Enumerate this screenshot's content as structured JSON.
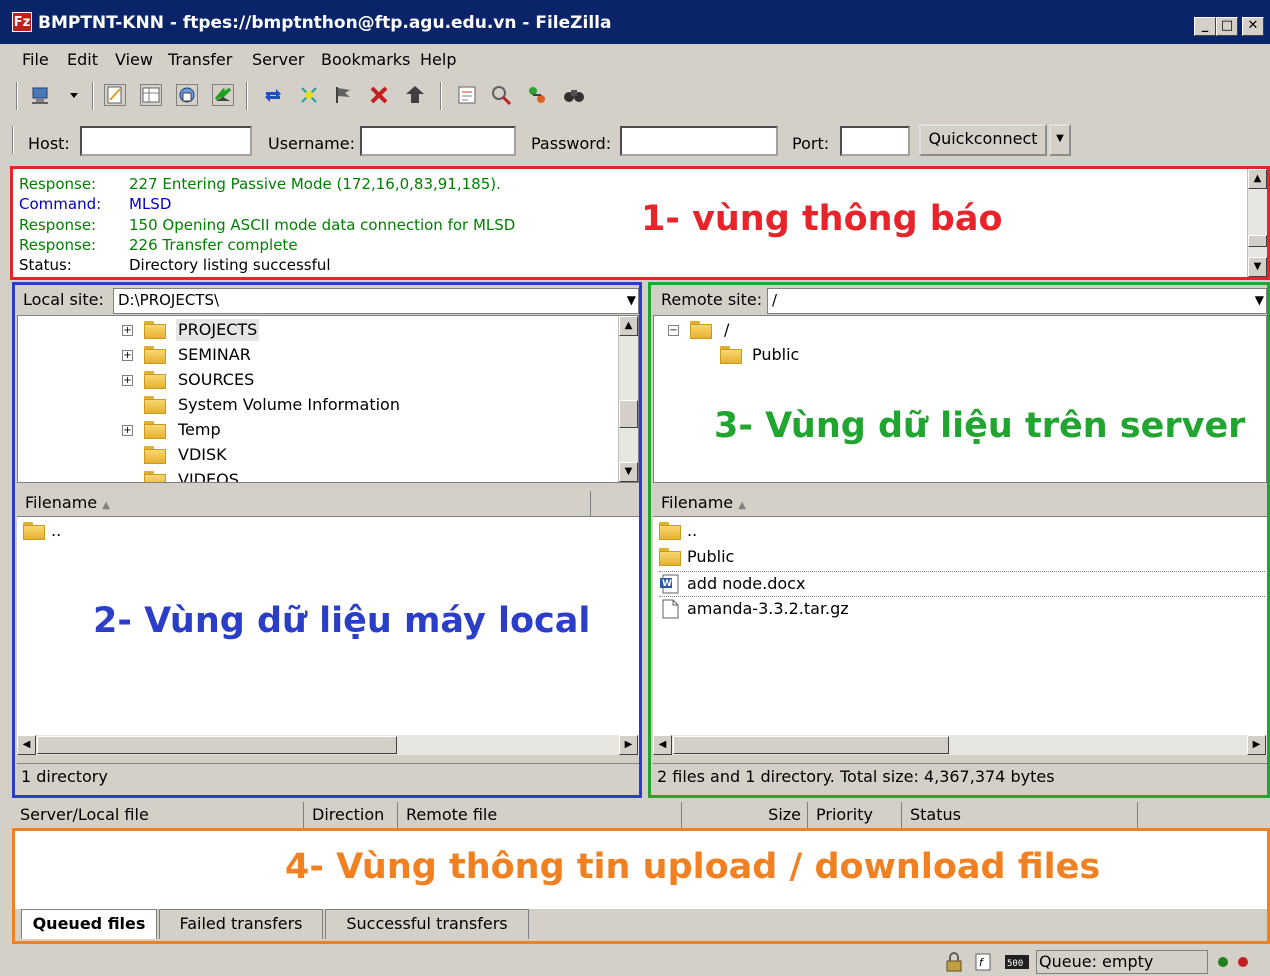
{
  "window": {
    "title": "BMPTNT-KNN - ftpes://bmptnthon@ftp.agu.edu.vn - FileZilla",
    "app_icon": "Fz",
    "minimize": "_",
    "maximize": "□",
    "close": "✕"
  },
  "menu": [
    "File",
    "Edit",
    "View",
    "Transfer",
    "Server",
    "Bookmarks",
    "Help"
  ],
  "toolbar_icons": [
    "site-manager-icon",
    "dropdown-arrow-icon",
    "message-log-icon",
    "local-tree-icon",
    "remote-tree-icon",
    "transfer-queue-icon",
    "refresh-icon",
    "process-queue-icon",
    "cancel-icon",
    "disconnect-icon",
    "reconnect-icon",
    "directory-listing-filters-icon",
    "compare-directories-icon",
    "sync-browsing-icon",
    "search-remote-icon"
  ],
  "quickconnect": {
    "host_label": "Host:",
    "host_value": "",
    "username_label": "Username:",
    "username_value": "",
    "password_label": "Password:",
    "password_value": "",
    "port_label": "Port:",
    "port_value": "",
    "button": "Quickconnect",
    "dropdown": "▼"
  },
  "log": {
    "lines": [
      {
        "key": "Response:",
        "text": "227 Entering Passive Mode (172,16,0,83,91,185).",
        "color": "#008000"
      },
      {
        "key": "Command:",
        "text": "MLSD",
        "color": "#0000c0"
      },
      {
        "key": "Response:",
        "text": "150 Opening ASCII mode data connection for MLSD",
        "color": "#008000"
      },
      {
        "key": "Response:",
        "text": "226 Transfer complete",
        "color": "#008000"
      },
      {
        "key": "Status:",
        "text": "Directory listing successful",
        "color": "#000000"
      }
    ],
    "annotation": "1- vùng thông báo",
    "annotation_color": "#e8242b"
  },
  "local": {
    "site_label": "Local site:",
    "path": "D:\\PROJECTS\\",
    "tree": [
      "PROJECTS",
      "SEMINAR",
      "SOURCES",
      "System Volume Information",
      "Temp",
      "VDISK",
      "VIDEOS"
    ],
    "col_filename": "Filename",
    "files": [
      ".."
    ],
    "annotation": "2- Vùng dữ liệu máy local",
    "annotation_color": "#2b3ec8",
    "status": "1 directory"
  },
  "remote": {
    "site_label": "Remote site:",
    "path": "/",
    "tree_root": "/",
    "tree_child": "Public",
    "col_filename": "Filename",
    "files": [
      "..",
      "Public",
      "add node.docx",
      "amanda-3.3.2.tar.gz"
    ],
    "annotation": "3- Vùng dữ liệu trên server",
    "annotation_color": "#21a531",
    "status": "2 files and 1 directory. Total size: 4,367,374 bytes"
  },
  "queue": {
    "columns": [
      "Server/Local file",
      "Direction",
      "Remote file",
      "Size",
      "Priority",
      "Status"
    ],
    "annotation": "4- Vùng thông tin upload / download files",
    "annotation_color": "#f08020",
    "tabs": [
      "Queued files",
      "Failed transfers",
      "Successful transfers"
    ]
  },
  "statusbar": {
    "queue": "Queue: empty"
  }
}
